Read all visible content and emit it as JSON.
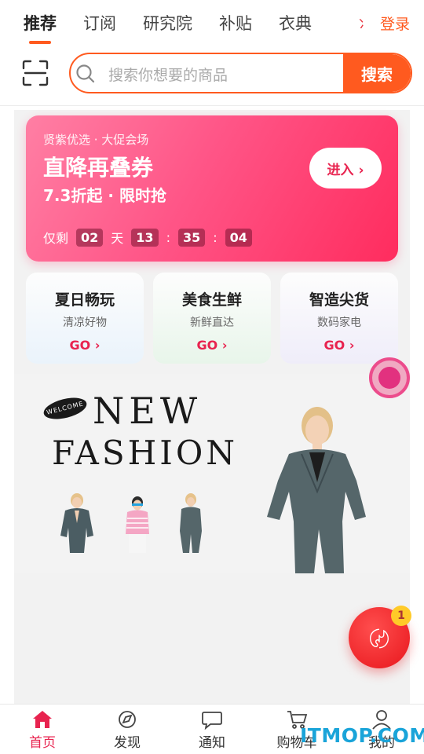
{
  "tabs": [
    "推荐",
    "订阅",
    "研究院",
    "补贴",
    "衣典"
  ],
  "tab_peek": "冫",
  "login": "登录",
  "search": {
    "placeholder": "搜索你想要的商品",
    "button": "搜索"
  },
  "promo": {
    "subtitle": "贤紫优选 · 大促会场",
    "title": "直降再叠券",
    "line": "7.3折起 · 限时抢",
    "enter": "进入 ›",
    "countdown": {
      "label": "仅剩",
      "days": "02",
      "day_unit": "天",
      "hours": "13",
      "minutes": "35",
      "seconds": "04",
      "sep": ":"
    }
  },
  "cards": [
    {
      "title": "夏日畅玩",
      "sub": "清凉好物",
      "go": "GO ›"
    },
    {
      "title": "美食生鲜",
      "sub": "新鲜直达",
      "go": "GO ›"
    },
    {
      "title": "智造尖货",
      "sub": "数码家电",
      "go": "GO ›"
    }
  ],
  "fashion": {
    "welcome": "WELCOME",
    "new": "NEW",
    "fashion": "FASHION"
  },
  "chat_badge": "1",
  "chat_glyph": "〄",
  "nav": [
    {
      "label": "首页",
      "icon": "home-icon",
      "active": true
    },
    {
      "label": "发现",
      "icon": "discover-icon"
    },
    {
      "label": "通知",
      "icon": "message-icon"
    },
    {
      "label": "购物车",
      "icon": "cart-icon"
    },
    {
      "label": "我的",
      "icon": "profile-icon"
    }
  ],
  "watermark": "ITMOP.COM",
  "colors": {
    "accent": "#ff5a1f",
    "promo": "#ff3d6e",
    "active_nav": "#e8234f"
  }
}
